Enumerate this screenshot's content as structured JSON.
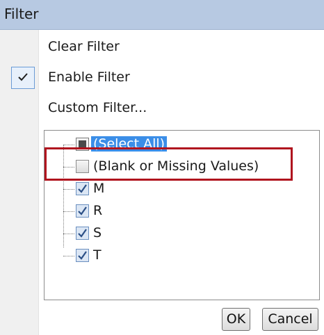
{
  "window": {
    "title": "Filter"
  },
  "menu": {
    "items": [
      {
        "label": "Clear Filter",
        "checked": false
      },
      {
        "label": "Enable Filter",
        "checked": true
      },
      {
        "label": "Custom Filter...",
        "checked": false
      }
    ]
  },
  "tree": {
    "items": [
      {
        "label": "(Select All)",
        "state": "partial",
        "selected": true
      },
      {
        "label": "(Blank or Missing Values)",
        "state": "unchecked",
        "selected": false
      },
      {
        "label": "M",
        "state": "checked",
        "selected": false
      },
      {
        "label": "R",
        "state": "checked",
        "selected": false
      },
      {
        "label": "S",
        "state": "checked",
        "selected": false
      },
      {
        "label": "T",
        "state": "checked",
        "selected": false
      }
    ]
  },
  "buttons": {
    "ok": "OK",
    "cancel": "Cancel"
  },
  "colors": {
    "highlight_border": "#b0141e",
    "selection": "#3b8ee8",
    "titlebar": "#b7c9e2"
  }
}
